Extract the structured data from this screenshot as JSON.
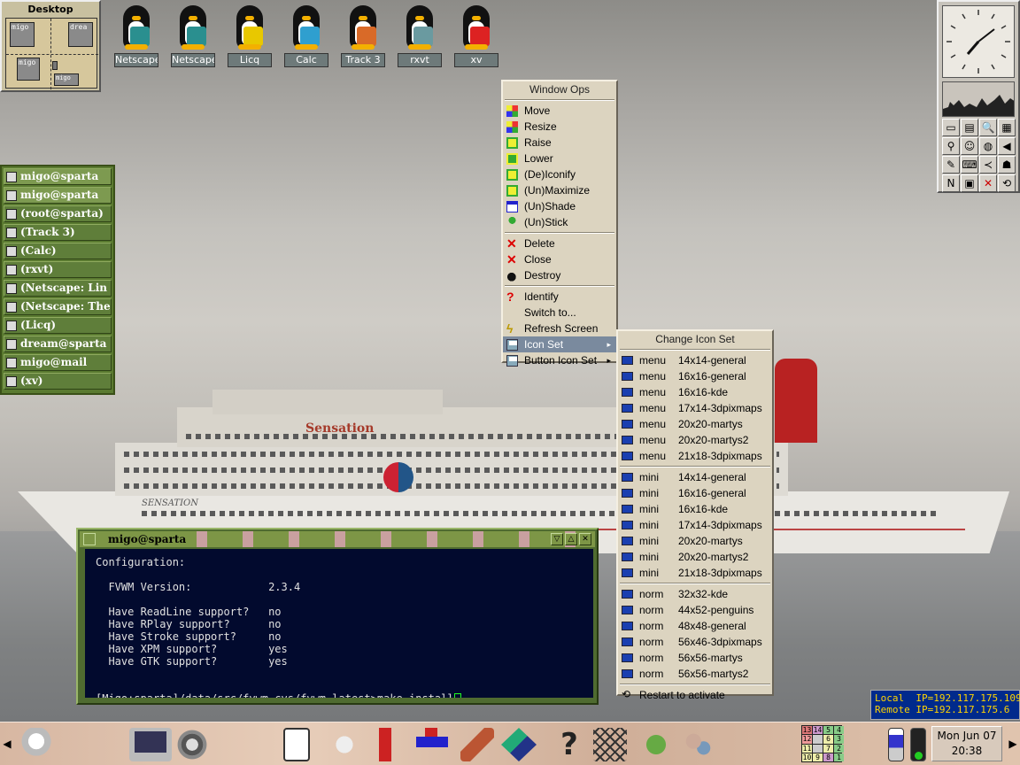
{
  "pager": {
    "title": "Desktop",
    "windows": [
      "migo",
      "drea",
      "migo",
      "migo"
    ]
  },
  "desktop_icons": [
    {
      "label": "Netscape",
      "icon": "penguin-netscape-icon",
      "color": "#2a8f8f"
    },
    {
      "label": "Netscape",
      "icon": "penguin-netscape-icon",
      "color": "#2a8f8f"
    },
    {
      "label": "Licq",
      "icon": "penguin-phone-icon",
      "color": "#e8c800"
    },
    {
      "label": "Calc",
      "icon": "penguin-calculator-icon",
      "color": "#2f9fcf"
    },
    {
      "label": "Track 3",
      "icon": "penguin-cd-icon",
      "color": "#d96a28"
    },
    {
      "label": "rxvt",
      "icon": "penguin-shell-icon",
      "color": "#6a9aa0"
    },
    {
      "label": "xv",
      "icon": "penguin-xv-icon",
      "color": "#d22"
    }
  ],
  "window_list": [
    {
      "label": "migo@sparta",
      "active": true
    },
    {
      "label": "migo@sparta",
      "active": true
    },
    {
      "label": "(root@sparta)",
      "active": false
    },
    {
      "label": "(Track 3)",
      "active": false
    },
    {
      "label": "(Calc)",
      "active": false
    },
    {
      "label": "(rxvt)",
      "active": false
    },
    {
      "label": "(Netscape: Lin",
      "active": false
    },
    {
      "label": "(Netscape: The",
      "active": false
    },
    {
      "label": "(Licq)",
      "active": false
    },
    {
      "label": "dream@sparta",
      "active": false
    },
    {
      "label": "migo@mail",
      "active": false
    },
    {
      "label": "(xv)",
      "active": false
    }
  ],
  "window_ops_menu": {
    "title": "Window Ops",
    "group1": [
      {
        "label": "Move",
        "icon": "move-icon"
      },
      {
        "label": "Resize",
        "icon": "resize-icon"
      },
      {
        "label": "Raise",
        "icon": "raise-icon"
      },
      {
        "label": "Lower",
        "icon": "lower-icon"
      },
      {
        "label": "(De)Iconify",
        "icon": "iconify-icon"
      },
      {
        "label": "(Un)Maximize",
        "icon": "maximize-icon"
      },
      {
        "label": "(Un)Shade",
        "icon": "shade-icon"
      },
      {
        "label": "(Un)Stick",
        "icon": "stick-pin-icon"
      }
    ],
    "group2": [
      {
        "label": "Delete",
        "icon": "delete-x-icon"
      },
      {
        "label": "Close",
        "icon": "close-x-icon"
      },
      {
        "label": "Destroy",
        "icon": "bomb-icon"
      }
    ],
    "group3": [
      {
        "label": "Identify",
        "icon": "question-icon"
      },
      {
        "label": "Switch to...",
        "icon": ""
      },
      {
        "label": "Refresh Screen",
        "icon": "lightning-icon"
      },
      {
        "label": "Icon Set",
        "icon": "printer-icon",
        "selected": true,
        "submenu": true
      },
      {
        "label": "Button Icon Set",
        "icon": "printer-icon",
        "submenu": true
      }
    ]
  },
  "icon_set_menu": {
    "title": "Change Icon Set",
    "menu_items": [
      {
        "type": "menu",
        "size": "14x14-general"
      },
      {
        "type": "menu",
        "size": "16x16-general"
      },
      {
        "type": "menu",
        "size": "16x16-kde"
      },
      {
        "type": "menu",
        "size": "17x14-3dpixmaps"
      },
      {
        "type": "menu",
        "size": "20x20-martys"
      },
      {
        "type": "menu",
        "size": "20x20-martys2"
      },
      {
        "type": "menu",
        "size": "21x18-3dpixmaps"
      }
    ],
    "mini_items": [
      {
        "type": "mini",
        "size": "14x14-general"
      },
      {
        "type": "mini",
        "size": "16x16-general"
      },
      {
        "type": "mini",
        "size": "16x16-kde"
      },
      {
        "type": "mini",
        "size": "17x14-3dpixmaps"
      },
      {
        "type": "mini",
        "size": "20x20-martys"
      },
      {
        "type": "mini",
        "size": "20x20-martys2"
      },
      {
        "type": "mini",
        "size": "21x18-3dpixmaps"
      }
    ],
    "norm_items": [
      {
        "type": "norm",
        "size": "32x32-kde"
      },
      {
        "type": "norm",
        "size": "44x52-penguins"
      },
      {
        "type": "norm",
        "size": "48x48-general"
      },
      {
        "type": "norm",
        "size": "56x46-3dpixmaps"
      },
      {
        "type": "norm",
        "size": "56x56-martys"
      },
      {
        "type": "norm",
        "size": "56x56-martys2"
      }
    ],
    "restart": "Restart to activate"
  },
  "terminal": {
    "title": "migo@sparta",
    "lines": [
      "Configuration:",
      "",
      "  FVWM Version:            2.3.4",
      "",
      "  Have ReadLine support?   no",
      "  Have RPlay support?      no",
      "  Have Stroke support?     no",
      "  Have XPM support?        yes",
      "  Have GTK support?        yes",
      "",
      ""
    ],
    "prompt": "[Migo:sparta]/data/src/fvwm-cvs/fvwm-latest>make install"
  },
  "ip_box": {
    "local": "Local  IP=192.117.175.109",
    "remote": "Remote IP=192.117.175.6"
  },
  "ship": {
    "name": "Sensation",
    "hull_name": "SENSATION"
  },
  "taskbar": {
    "date": "Mon Jun 07",
    "time": "20:38",
    "pager_numbers": [
      "13",
      "14",
      "5",
      "4",
      "12",
      "",
      "6",
      "3",
      "11",
      "",
      "7",
      "2",
      "10",
      "9",
      "8",
      "1"
    ]
  },
  "panel_buttons": [
    "computer-icon",
    "folder-icon",
    "search-icon",
    "calculator-icon",
    "network-icon",
    "smiley-icon",
    "globe-icon",
    "speaker-icon",
    "editor-icon",
    "keyboard-icon",
    "fish-icon",
    "ghost-icon",
    "netscape-n-icon",
    "lock-icon",
    "close-x-icon",
    "refresh-icon"
  ]
}
